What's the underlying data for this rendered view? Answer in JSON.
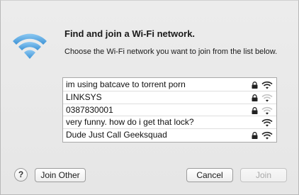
{
  "dialog": {
    "title": "Find and join a Wi-Fi network.",
    "subtitle": "Choose the Wi-Fi network you want to join from the list below.",
    "icon": "wifi-logo-icon",
    "accent_color": "#4aa3e0"
  },
  "networks": [
    {
      "name": "im using batcave to torrent porn",
      "locked": true,
      "signal": 3
    },
    {
      "name": "LINKSYS",
      "locked": true,
      "signal": 1
    },
    {
      "name": "0387830001",
      "locked": true,
      "signal": 1
    },
    {
      "name": "very funny. how do i get that lock?",
      "locked": false,
      "signal": 3
    },
    {
      "name": "Dude Just Call Geeksquad",
      "locked": true,
      "signal": 3
    }
  ],
  "buttons": {
    "help": "?",
    "join_other": "Join Other",
    "cancel": "Cancel",
    "join": "Join"
  }
}
